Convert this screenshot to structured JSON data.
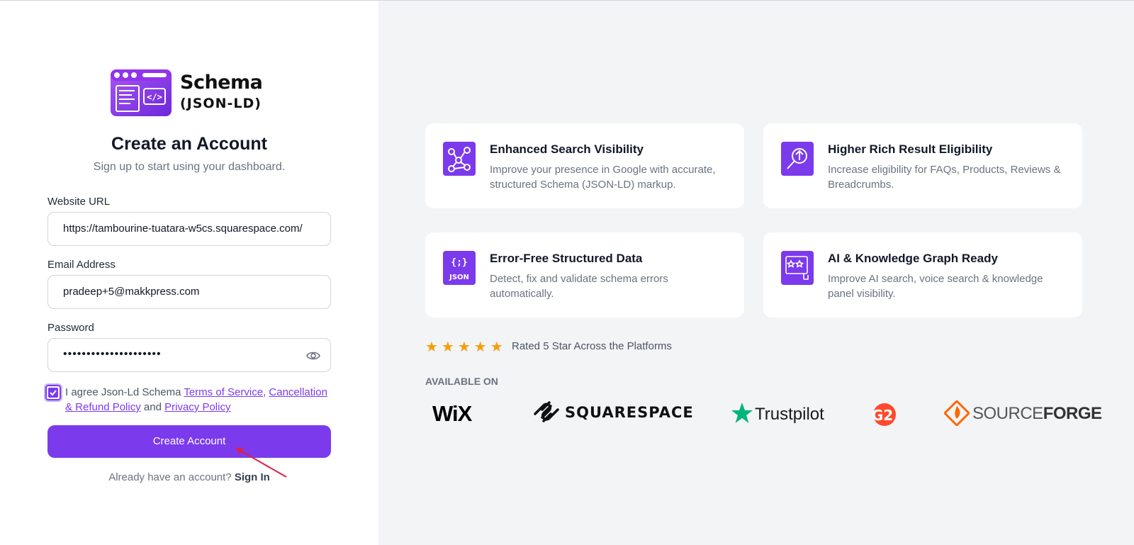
{
  "brand": {
    "title": "Schema",
    "subtitle": "(JSON-LD)",
    "accent": "#7c3aed"
  },
  "form": {
    "heading": "Create an Account",
    "subheading": "Sign up to start using your dashboard.",
    "website_label": "Website URL",
    "website_value": "https://tambourine-tuatara-w5cs.squarespace.com/",
    "email_label": "Email Address",
    "email_value": "pradeep+5@makkpress.com",
    "password_label": "Password",
    "password_value": "•••••••••••••••••••••",
    "agree_prefix": "I agree Json-Ld Schema",
    "terms_link": "Terms of Service",
    "refund_link": "Cancellation & Refund Policy",
    "and_text": "and",
    "privacy_link": "Privacy Policy",
    "submit_label": "Create Account",
    "signin_prompt": "Already have an account?",
    "signin_link": "Sign In"
  },
  "features": [
    {
      "title": "Enhanced Search Visibility",
      "desc": "Improve your presence in Google with accurate, structured Schema (JSON-LD) markup.",
      "icon": "network-graph-icon"
    },
    {
      "title": "Higher Rich Result Eligibility",
      "desc": "Increase eligibility for FAQs, Products, Reviews & Breadcrumbs.",
      "icon": "magnifier-upload-icon"
    },
    {
      "title": "Error-Free Structured Data",
      "desc": "Detect, fix and validate schema errors automatically.",
      "icon": "json-icon"
    },
    {
      "title": "AI & Knowledge Graph Ready",
      "desc": "Improve AI search, voice search & knowledge panel visibility.",
      "icon": "star-review-icon"
    }
  ],
  "rating": {
    "stars": "★★★★★",
    "text": "Rated 5 Star Across the Platforms"
  },
  "available": {
    "label": "AVAILABLE ON",
    "platforms": [
      "WiX",
      "SQUARESPACE",
      "Trustpilot",
      "G2",
      "SOURCE",
      "FORGE"
    ]
  }
}
